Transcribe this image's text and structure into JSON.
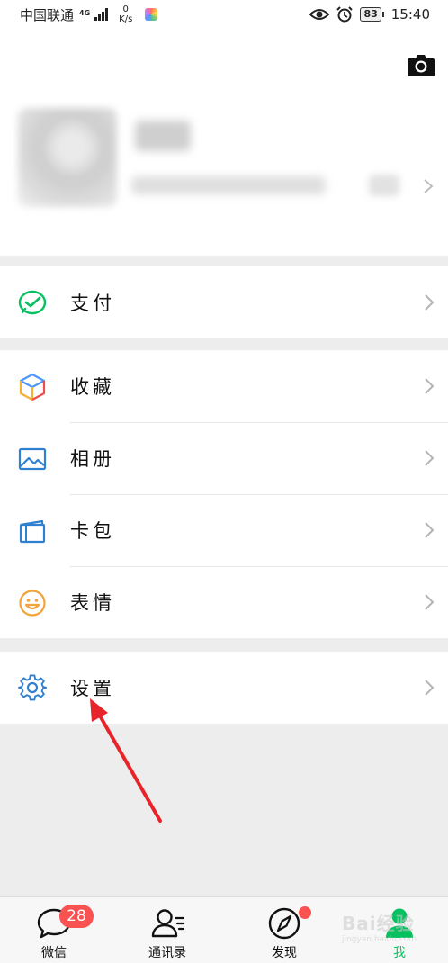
{
  "status_bar": {
    "carrier": "中国联通",
    "network": "4G",
    "speed_value": "0",
    "speed_unit": "K/s",
    "battery": "83",
    "time": "15:40",
    "icons": [
      "signal-bars-icon",
      "app-notification-icon",
      "eye-icon",
      "alarm-clock-icon",
      "battery-icon"
    ]
  },
  "header": {
    "icons": [
      "camera-icon",
      "chevron-right-icon"
    ]
  },
  "menu": {
    "pay": {
      "label": "支付",
      "icon": "wechat-pay-icon"
    },
    "favorites": {
      "label": "收藏",
      "icon": "favorites-cube-icon"
    },
    "album": {
      "label": "相册",
      "icon": "album-picture-icon"
    },
    "cards": {
      "label": "卡包",
      "icon": "card-wallet-icon"
    },
    "stickers": {
      "label": "表情",
      "icon": "smiley-face-icon"
    },
    "settings": {
      "label": "设置",
      "icon": "settings-gear-icon"
    }
  },
  "tab_bar": {
    "chats": {
      "label": "微信",
      "badge": "28",
      "icon": "chat-bubble-icon"
    },
    "contacts": {
      "label": "通讯录",
      "icon": "contacts-person-icon"
    },
    "discover": {
      "label": "发现",
      "icon": "compass-icon"
    },
    "me": {
      "label": "我",
      "icon": "me-person-icon"
    }
  },
  "watermark": {
    "brand": "Bai经验",
    "url": "jingyan.baidu.com"
  },
  "colors": {
    "accent_green": "#07c160",
    "badge_red": "#fa5151",
    "annotation_red": "#e8242b",
    "background": "#ededed"
  }
}
